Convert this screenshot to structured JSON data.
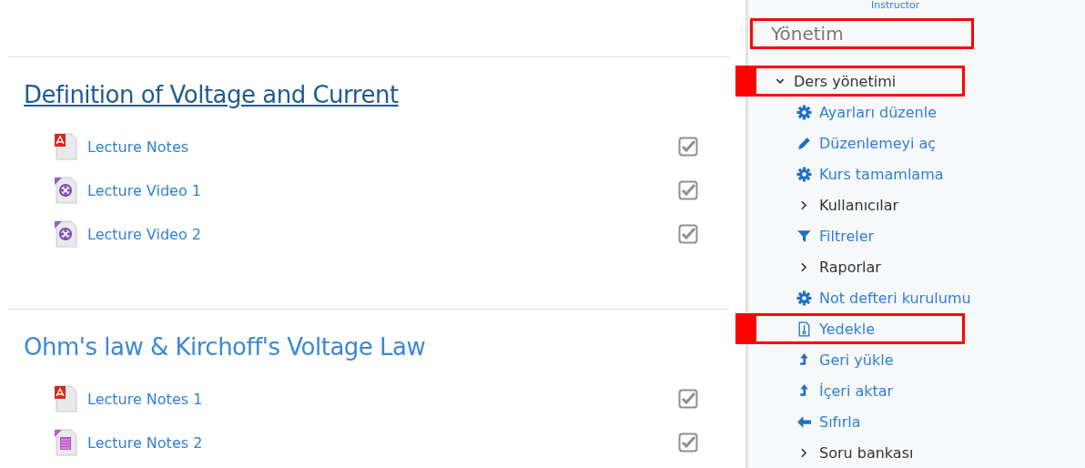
{
  "sections": [
    {
      "title": "Definition of Voltage and Current",
      "linked": true,
      "activities": [
        {
          "kind": "pdf",
          "label": "Lecture Notes",
          "completed": true
        },
        {
          "kind": "video",
          "label": "Lecture Video 1",
          "completed": true
        },
        {
          "kind": "video",
          "label": "Lecture Video 2",
          "completed": true
        }
      ]
    },
    {
      "title": "Ohm's law & Kirchoff's Voltage Law",
      "linked": false,
      "activities": [
        {
          "kind": "pdf",
          "label": "Lecture Notes 1",
          "completed": true
        },
        {
          "kind": "text",
          "label": "Lecture Notes 2",
          "completed": true
        }
      ]
    }
  ],
  "sidebar": {
    "role": "Instructor",
    "heading": {
      "text": "Yönetim",
      "highlighted": true
    },
    "tree": {
      "label": "Ders yönetimi",
      "expanded": true,
      "highlighted": true,
      "children": [
        {
          "kind": "gear",
          "label": "Ayarları düzenle",
          "highlighted": false
        },
        {
          "kind": "pencil",
          "label": "Düzenlemeyi aç",
          "highlighted": false
        },
        {
          "kind": "gear",
          "label": "Kurs tamamlama",
          "highlighted": false
        },
        {
          "kind": "branch",
          "label": "Kullanıcılar",
          "highlighted": false
        },
        {
          "kind": "filter",
          "label": "Filtreler",
          "highlighted": false
        },
        {
          "kind": "branch",
          "label": "Raporlar",
          "highlighted": false
        },
        {
          "kind": "gear",
          "label": "Not defteri kurulumu",
          "highlighted": false
        },
        {
          "kind": "archive",
          "label": "Yedekle",
          "highlighted": true
        },
        {
          "kind": "upload",
          "label": "Geri yükle",
          "highlighted": false
        },
        {
          "kind": "upload",
          "label": "İçeri aktar",
          "highlighted": false
        },
        {
          "kind": "back",
          "label": "Sıfırla",
          "highlighted": false
        },
        {
          "kind": "branch",
          "label": "Soru bankası",
          "highlighted": false
        }
      ]
    }
  }
}
